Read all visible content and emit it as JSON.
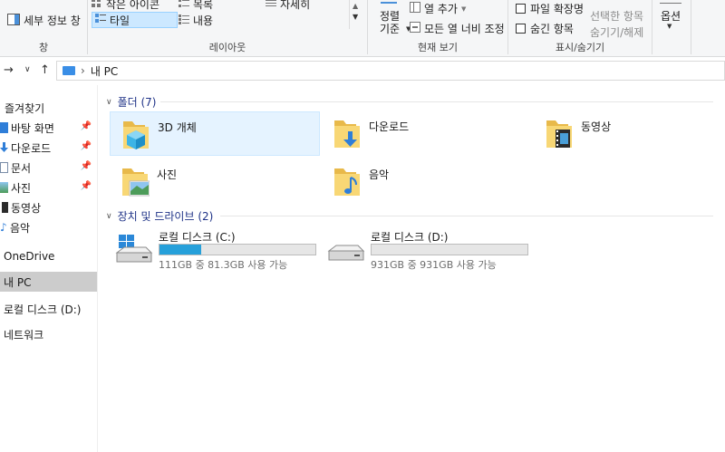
{
  "ribbon": {
    "details_pane": "세부 정보 창",
    "pane_group_label": "창",
    "layout_group_label": "레이아웃",
    "layout_small_icons": "작은 아이콘",
    "layout_list": "목록",
    "layout_details": "자세히",
    "layout_tiles": "타일",
    "layout_content": "내용",
    "sort_by_line1": "정렬",
    "sort_by_line2": "기준",
    "add_column": "열 추가",
    "size_all_columns": "모든 열 너비 조정",
    "current_view_group_label": "현재 보기",
    "file_extensions": "파일 확장명",
    "hidden_items": "숨긴 항목",
    "hide_selected_line1": "선택한 항목",
    "hide_selected_line2": "숨기기/해제",
    "show_hide_group_label": "표시/숨기기",
    "options": "옵션"
  },
  "address": {
    "path": "내 PC"
  },
  "sidebar": {
    "items": [
      {
        "label": "즐겨찾기"
      },
      {
        "label": "바탕 화면"
      },
      {
        "label": "다운로드"
      },
      {
        "label": "문서"
      },
      {
        "label": "사진"
      },
      {
        "label": "동영상"
      },
      {
        "label": "음악"
      },
      {
        "label": "OneDrive"
      },
      {
        "label": "내 PC"
      },
      {
        "label": "로컬 디스크 (D:)"
      },
      {
        "label": "네트워크"
      }
    ]
  },
  "main": {
    "folders_header": "폴더 (7)",
    "folders": [
      {
        "name": "3D 개체"
      },
      {
        "name": "다운로드"
      },
      {
        "name": "동영상"
      },
      {
        "name": "사진"
      },
      {
        "name": "음악"
      }
    ],
    "drives_header": "장치 및 드라이브 (2)",
    "drives": [
      {
        "name": "로컬 디스크 (C:)",
        "info": "111GB 중 81.3GB 사용 가능",
        "used_fraction": 0.27
      },
      {
        "name": "로컬 디스크 (D:)",
        "info": "931GB 중 931GB 사용 가능",
        "used_fraction": 0.0
      }
    ]
  },
  "colors": {
    "accent": "#26a0da",
    "folder": "#f8d775",
    "selection": "#cce8ff",
    "header_text": "#1e3287"
  }
}
